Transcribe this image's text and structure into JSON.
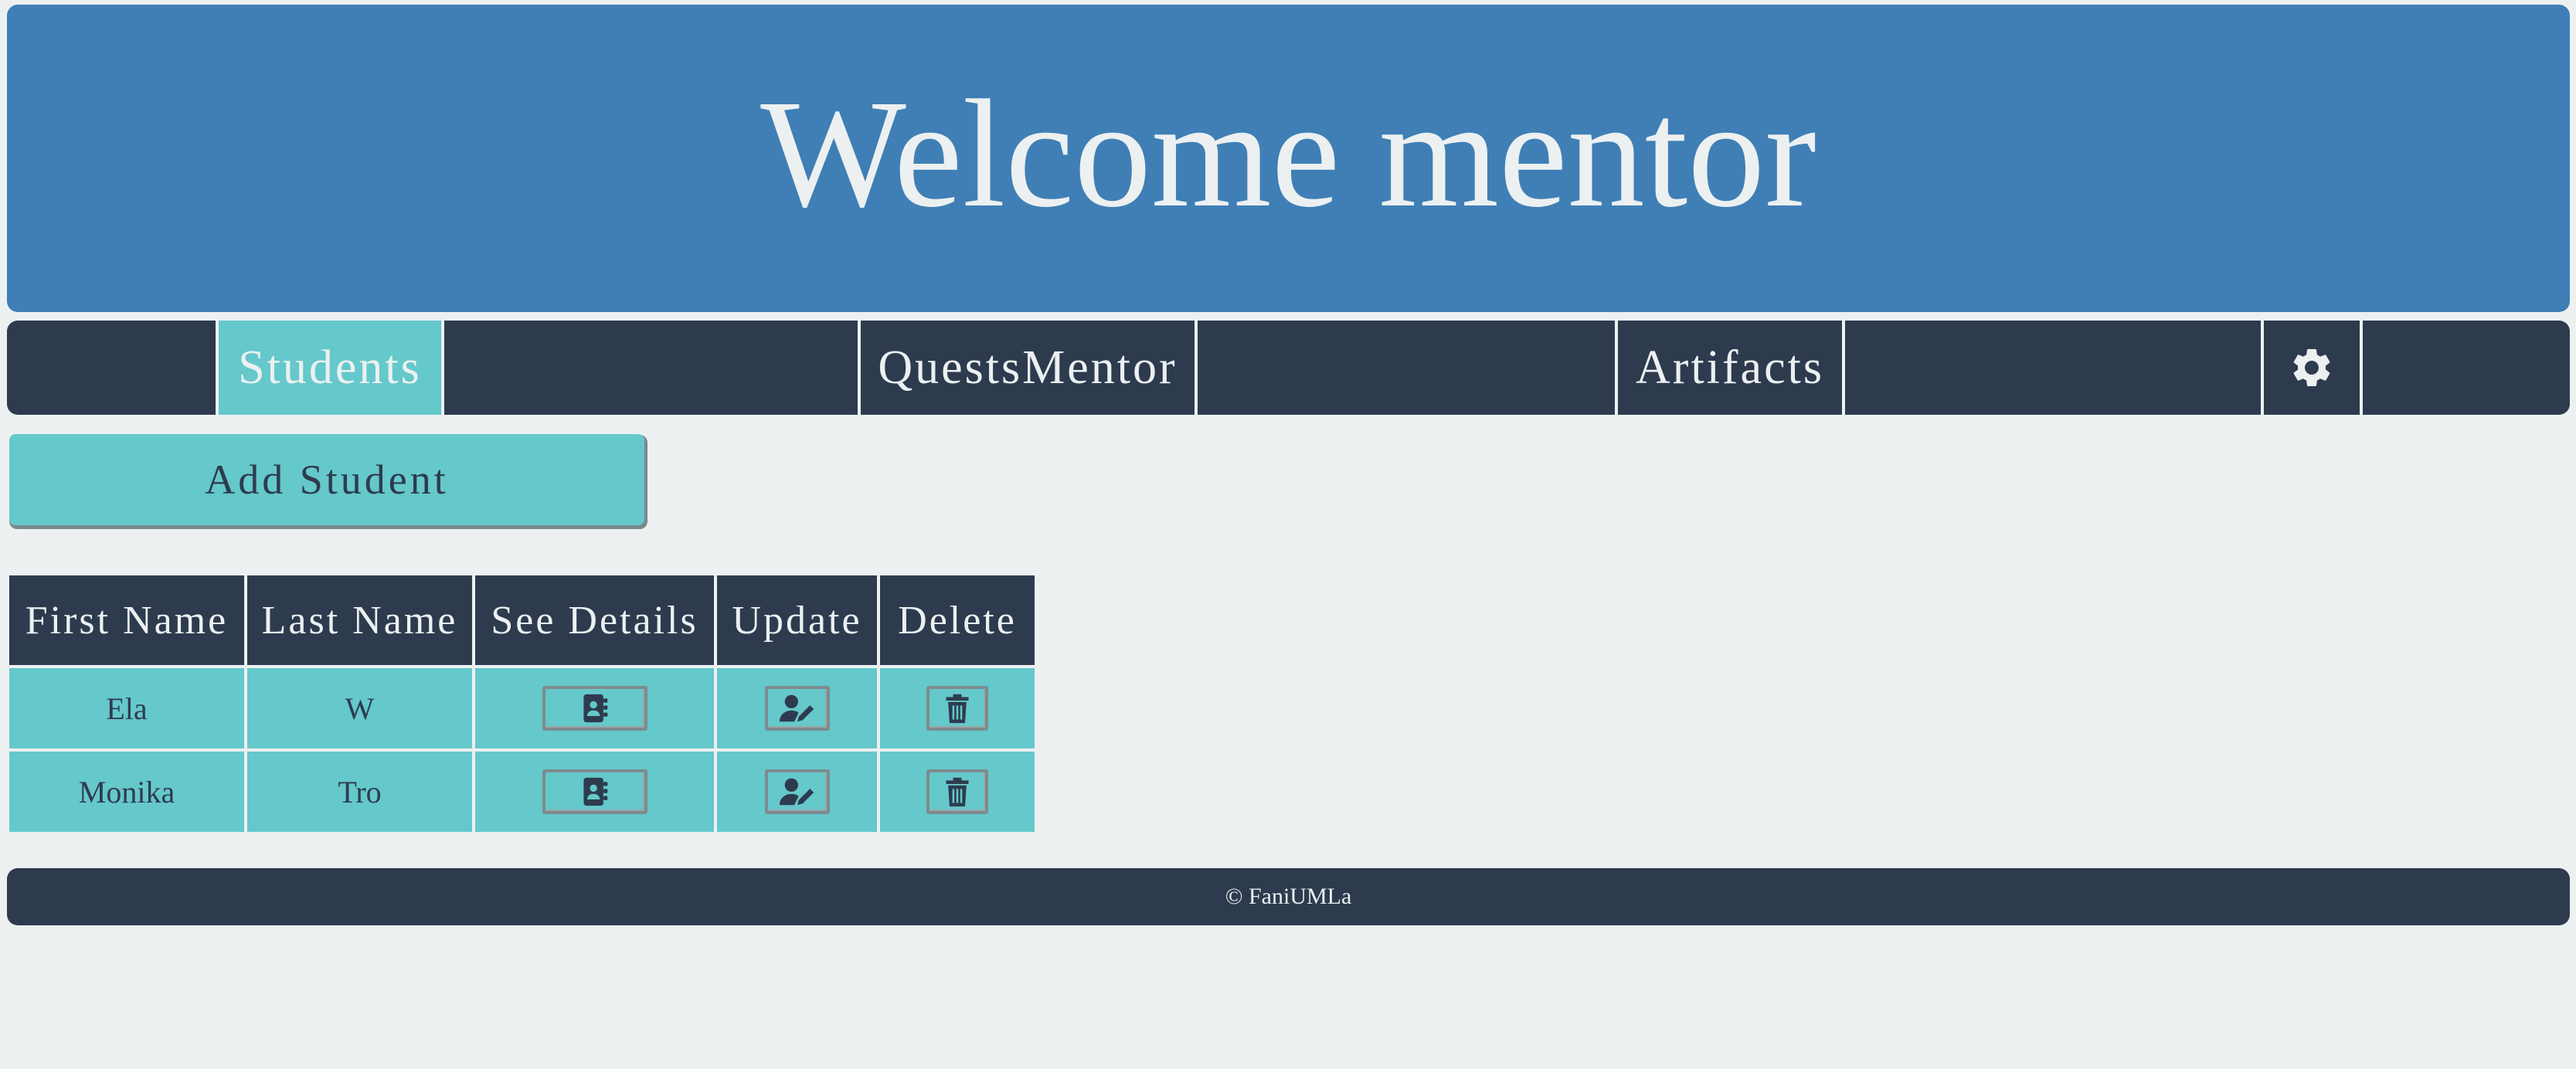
{
  "header": {
    "title": "Welcome mentor"
  },
  "nav": {
    "items": [
      {
        "label": "Students",
        "active": true
      },
      {
        "label": "QuestsMentor",
        "active": false
      },
      {
        "label": "Artifacts",
        "active": false
      }
    ],
    "settings_icon": "gear-icon"
  },
  "actions": {
    "add_student_label": "Add Student"
  },
  "table": {
    "headers": [
      "First Name",
      "Last Name",
      "See Details",
      "Update",
      "Delete"
    ],
    "rows": [
      {
        "first_name": "Ela",
        "last_name": "W"
      },
      {
        "first_name": "Monika",
        "last_name": "Tro"
      }
    ],
    "icons": {
      "details": "address-book-icon",
      "update": "user-edit-icon",
      "delete": "trash-icon"
    }
  },
  "footer": {
    "text": "© FaniUMLa"
  },
  "colors": {
    "header_bg": "#3f7fb5",
    "nav_bg": "#2e3b4e",
    "accent": "#65c8cb",
    "page_bg": "#ecf0f1"
  }
}
